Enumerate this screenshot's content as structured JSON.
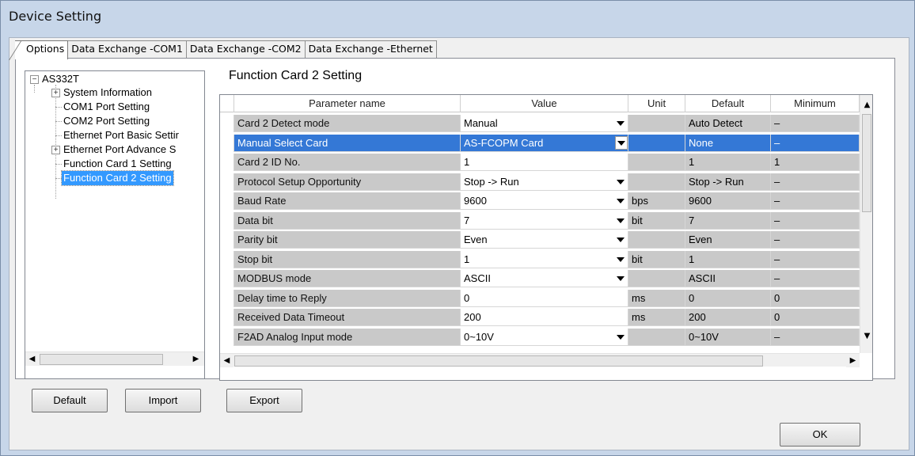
{
  "window": {
    "title": "Device Setting"
  },
  "tabs": [
    {
      "label": "Options"
    },
    {
      "label": "Data Exchange -COM1"
    },
    {
      "label": "Data Exchange -COM2"
    },
    {
      "label": "Data Exchange -Ethernet"
    }
  ],
  "tree": {
    "root": {
      "label": "AS332T",
      "expander": "−"
    },
    "items": [
      {
        "label": "System Information",
        "expander": "+"
      },
      {
        "label": "COM1 Port Setting"
      },
      {
        "label": "COM2 Port Setting"
      },
      {
        "label": "Ethernet Port Basic Settir"
      },
      {
        "label": "Ethernet Port Advance S",
        "expander": "+"
      },
      {
        "label": "Function Card 1 Setting"
      },
      {
        "label": "Function Card 2 Setting",
        "selected": true
      }
    ]
  },
  "panel": {
    "title": "Function Card 2 Setting"
  },
  "grid": {
    "columns": [
      "Parameter name",
      "Value",
      "Unit",
      "Default",
      "Minimum"
    ],
    "rows": [
      {
        "name": "Card 2 Detect mode",
        "value": "Manual",
        "dropdown": true,
        "unit": "",
        "default": "Auto Detect",
        "min": "–"
      },
      {
        "name": "Manual Select Card",
        "value": "AS-FCOPM Card",
        "dropdown": true,
        "unit": "",
        "default": "None",
        "min": "–",
        "selected": true
      },
      {
        "name": "Card 2 ID No.",
        "value": "1",
        "dropdown": false,
        "unit": "",
        "default": "1",
        "min": "1"
      },
      {
        "name": "Protocol Setup Opportunity",
        "value": "Stop -> Run",
        "dropdown": true,
        "unit": "",
        "default": "Stop -> Run",
        "min": "–"
      },
      {
        "name": "Baud Rate",
        "value": "9600",
        "dropdown": true,
        "unit": "bps",
        "default": "9600",
        "min": "–"
      },
      {
        "name": "Data bit",
        "value": "7",
        "dropdown": true,
        "unit": "bit",
        "default": "7",
        "min": "–"
      },
      {
        "name": "Parity bit",
        "value": "Even",
        "dropdown": true,
        "unit": "",
        "default": "Even",
        "min": "–"
      },
      {
        "name": "Stop bit",
        "value": "1",
        "dropdown": true,
        "unit": "bit",
        "default": "1",
        "min": "–"
      },
      {
        "name": "MODBUS mode",
        "value": "ASCII",
        "dropdown": true,
        "unit": "",
        "default": "ASCII",
        "min": "–"
      },
      {
        "name": "Delay time to Reply",
        "value": "0",
        "dropdown": false,
        "unit": "ms",
        "default": "0",
        "min": "0"
      },
      {
        "name": "Received Data Timeout",
        "value": "200",
        "dropdown": false,
        "unit": "ms",
        "default": "200",
        "min": "0"
      },
      {
        "name": "F2AD Analog Input mode",
        "value": "0~10V",
        "dropdown": true,
        "unit": "",
        "default": "0~10V",
        "min": "–"
      }
    ]
  },
  "buttons": {
    "default": "Default",
    "import": "Import",
    "export": "Export",
    "ok": "OK"
  },
  "icons": {
    "scroll_left": "◀",
    "scroll_right": "▶",
    "scroll_up": "▲",
    "scroll_down": "▼"
  }
}
